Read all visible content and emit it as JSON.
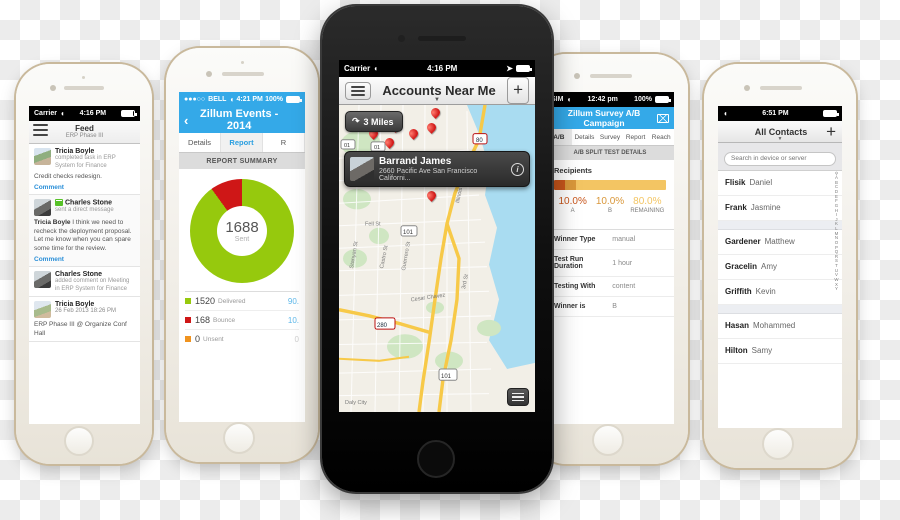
{
  "phone_feed": {
    "status": {
      "carrier": "Carrier",
      "wifi": "wifi-icon",
      "time": "4:16 PM"
    },
    "nav": {
      "menu": "menu-icon",
      "title": "Feed",
      "subtitle": "ERP Phase III"
    },
    "items": [
      {
        "name": "Tricia Boyle",
        "action": "completed task in ERP System for Finance",
        "body": "Credit checks redesign.",
        "link": "Comment"
      },
      {
        "name": "Charles Stone",
        "action": "sent a direct message",
        "body_author": "Tricia Boyle",
        "body": " I think we need to recheck the deployment proposal. Let me know when you can spare some time for the review.",
        "link": "Comment"
      },
      {
        "name": "Charles Stone",
        "action": "added comment on Meeting in ERP System for Finance"
      },
      {
        "name": "Tricia Boyle",
        "action": "26 Feb 2013 18:26 PM",
        "body": "ERP Phase III @ Organize Conf Hall"
      }
    ]
  },
  "phone_events": {
    "status": {
      "carrier": "BELL",
      "time": "4:21 PM",
      "battery": "100%"
    },
    "nav": {
      "back": "back-chevron-icon",
      "title": "Zillum Events - 2014"
    },
    "tabs": [
      {
        "label": "Details",
        "active": false
      },
      {
        "label": "Report",
        "active": true
      },
      {
        "label": "R",
        "active": false
      }
    ],
    "section_header": "REPORT SUMMARY",
    "chart_data": {
      "type": "pie",
      "title": "Report Summary",
      "center_value": "1688",
      "center_label": "Sent",
      "total": 1688,
      "categories": [
        "Delivered",
        "Bounce",
        "Unsent"
      ],
      "values": [
        1520,
        168,
        0
      ],
      "percentages": [
        "90.",
        "10.",
        "0"
      ],
      "colors": [
        "#96c90d",
        "#cf1717",
        "#f0931f"
      ],
      "legend_position": "bottom"
    }
  },
  "phone_map": {
    "status": {
      "carrier": "Carrier",
      "time": "4:16 PM",
      "location": "location-arrow-icon",
      "battery": "full"
    },
    "nav": {
      "menu": "menu-icon",
      "title": "Accounts Near Me",
      "caret": "chevron-down-icon",
      "add": "+"
    },
    "radius_button": {
      "icon": "directions-icon",
      "label": "3 Miles"
    },
    "callout": {
      "name": "Barrand James",
      "address": "2660 Pacific Ave San Francisco Californi...",
      "info": "info-icon"
    },
    "map_labels": [
      "01",
      "101",
      "280",
      "80",
      "Fell St",
      "Castro St",
      "Guerrero St",
      "Cesar Chavez",
      "3rd St",
      "Daly City",
      "Stanyan St"
    ],
    "pins_red": 11,
    "pins_blue": 1,
    "list_button": "list-view-icon"
  },
  "phone_ab": {
    "status": {
      "carrier": "SIM",
      "time": "12:42 pm",
      "battery": "100%"
    },
    "nav": {
      "title": "Zillum Survey A/B Campaign",
      "mail": "envelope-icon"
    },
    "tabs": [
      {
        "label": "A/B",
        "active": true
      },
      {
        "label": "Details",
        "active": false
      },
      {
        "label": "Survey",
        "active": false
      },
      {
        "label": "Report",
        "active": false
      },
      {
        "label": "Reach",
        "active": false
      }
    ],
    "section_header": "A/B SPLIT TEST DETAILS",
    "recipients_label": "Recipients",
    "chart_data": {
      "type": "bar",
      "title": "Recipients split",
      "categories": [
        "A",
        "B",
        "REMAINING"
      ],
      "values": [
        10.0,
        10.0,
        80.0
      ],
      "value_labels": [
        "10.0%",
        "10.0%",
        "80.0%"
      ],
      "colors": [
        "#c8551b",
        "#d9973a",
        "#f3c563"
      ],
      "stacked": true,
      "ylabel": "%",
      "ylim": [
        0,
        100
      ]
    },
    "rows": [
      {
        "key": "Winner Type",
        "value": "manual"
      },
      {
        "key": "Test Run Duration",
        "value": "1 hour"
      },
      {
        "key": "Testing With",
        "value": "content"
      },
      {
        "key": "Winner is",
        "value": "B"
      }
    ]
  },
  "phone_contacts": {
    "status": {
      "wifi": "wifi-icon",
      "time": "6:51 PM",
      "battery": "full"
    },
    "nav": {
      "title": "All Contacts",
      "caret": "chevron-down-icon",
      "add": "+"
    },
    "search": {
      "placeholder": "Search in device or server",
      "value": "",
      "icon": "search-icon"
    },
    "contacts": [
      {
        "last": "Flisik",
        "first": "Daniel"
      },
      {
        "last": "Frank",
        "first": "Jasmine"
      },
      {
        "last": "Gardener",
        "first": "Matthew"
      },
      {
        "last": "Gracelin",
        "first": "Amy"
      },
      {
        "last": "Griffith",
        "first": "Kevin"
      },
      {
        "last": "Hasan",
        "first": "Mohammed"
      },
      {
        "last": "Hilton",
        "first": "Samy"
      }
    ],
    "index_letters": [
      "A",
      "B",
      "C",
      "D",
      "E",
      "F",
      "G",
      "H",
      "I",
      "J",
      "K",
      "L",
      "M",
      "N",
      "O",
      "P",
      "Q",
      "R",
      "S",
      "T",
      "U",
      "V",
      "W",
      "X",
      "Y"
    ]
  }
}
